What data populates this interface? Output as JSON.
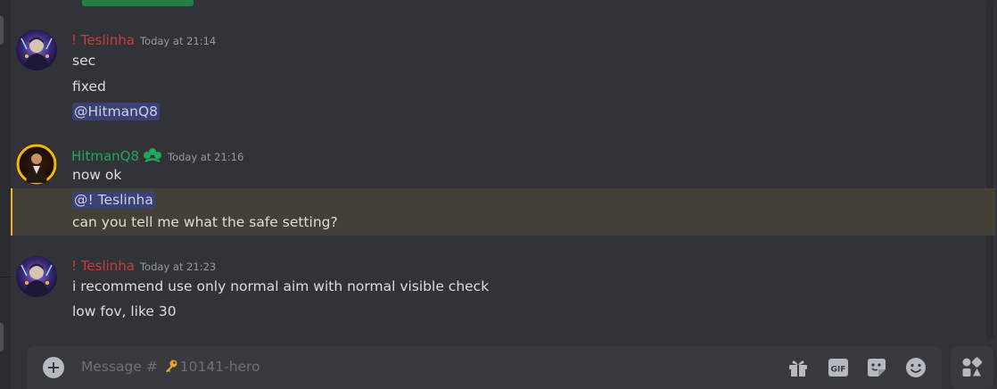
{
  "messages": [
    {
      "author": "! Teslinha",
      "timestamp": "Today at 21:14",
      "lines": [
        "sec",
        "fixed"
      ],
      "mention": "@HitmanQ8"
    },
    {
      "author": "HitmanQ8",
      "timestamp": "Today at 21:16",
      "lines": [
        "now ok"
      ],
      "mention": "@! Teslinha",
      "after_mention": "can you tell me what the safe setting?"
    },
    {
      "author": "! Teslinha",
      "timestamp": "Today at 21:23",
      "lines": [
        "i recommend use only normal aim with normal visible check",
        "low fov, like 30"
      ]
    }
  ],
  "composer": {
    "placeholder_prefix": "Message #",
    "channel_icon": "key-icon",
    "channel_name": "10141-hero",
    "gif_label": "GIF"
  },
  "colors": {
    "background": "#313338",
    "teslinha_name": "#c93c3c",
    "hitman_name": "#23a55a",
    "mention_bg": "#3c4270",
    "highlight_bg": "#444036",
    "highlight_border": "#f0b232"
  }
}
